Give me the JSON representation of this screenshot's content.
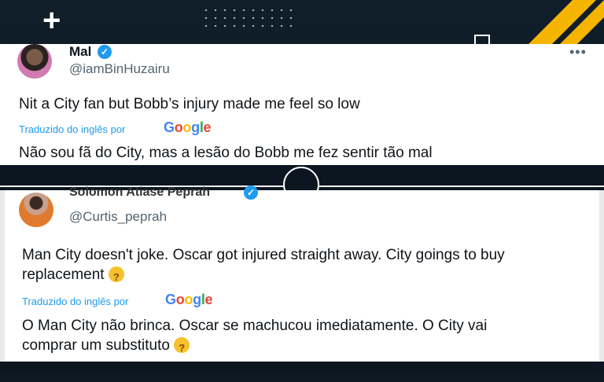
{
  "colors": {
    "accent": "#1d9bf0",
    "brand_stripe": "#f4b400",
    "background": "#0d1a24"
  },
  "tweets": [
    {
      "name": "Mal",
      "handle": "@iamBinHuzairu",
      "text": "Nit a City fan but Bobb’s injury made me feel so low",
      "translated_label": "Traduzido do inglês por",
      "translation": "Não sou fã do City, mas a lesão do Bobb me fez sentir tão mal",
      "more_icon": "more-icon"
    },
    {
      "name": "Solomon Atiase Peprah",
      "handle": "@Curtis_peprah",
      "text_line1": "Man City doesn't joke. Oscar got injured straight away. City goings to buy",
      "text_line2": "replacement",
      "translated_label": "Traduzido do inglês por",
      "translation_line1": "O Man City não brinca. Oscar se machucou imediatamente. O City vai",
      "translation_line2": "comprar um substituto"
    }
  ],
  "google_logo": {
    "g1": "G",
    "g2": "o",
    "g3": "o",
    "g4": "g",
    "g5": "l",
    "g6": "e"
  },
  "decor": {
    "plus": "+",
    "more": "•••"
  }
}
